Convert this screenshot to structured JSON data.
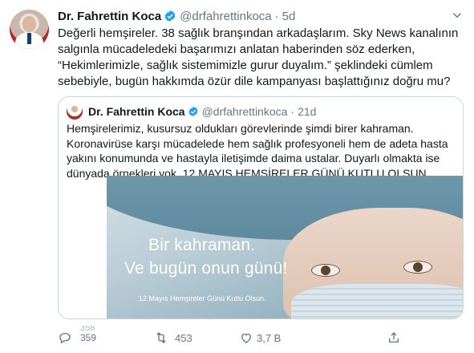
{
  "tweet": {
    "name": "Dr. Fahrettin Koca",
    "handle": "@drfahrettinkoca",
    "separator": "·",
    "time": "5d",
    "text": "Değerli hemşireler. 38 sağlık branşından arkadaşlarım. Sky News kanalının\nsalgınla mücadeledeki başarımızı anlatan haberinden söz ederken,\n“Hekimlerimizle, sağlık sistemimizle gurur duyalım.” şeklindeki cümlem\nsebebiyle, bugün hakkımda özür dile kampanyası başlattığınız doğru mu?"
  },
  "quoted": {
    "name": "Dr. Fahrettin Koca",
    "handle": "@drfahrettinkoca",
    "separator": "·",
    "time": "21d",
    "text": "Hemşirelerimiz, kusursuz oldukları görevlerinde şimdi birer kahraman.\nKoronavirüse karşı mücadelede hem sağlık profesyoneli hem de adeta hasta\nyakını konumunda ve hastayla iletişimde daima ustalar. Duyarlı olmakta ise\ndünyada örnekleri yok. 12 MAYIS HEMŞİRELER GÜNÜ KUTLU OLSUN.",
    "media": {
      "line1": "Bir kahraman.",
      "line2": "Ve bugün onun günü!",
      "small": "12 Mayıs Hemşireler Günü Kutlu Olsun."
    }
  },
  "actions": {
    "reply_count_old": "358",
    "reply_count": "359",
    "retweet_count": "453",
    "like_count": "3,7 B",
    "icons": [
      "reply-icon",
      "retweet-icon",
      "like-icon",
      "share-icon"
    ]
  },
  "colors": {
    "accent": "#1da1f2",
    "muted": "#657786",
    "border": "#ccd6dd"
  }
}
